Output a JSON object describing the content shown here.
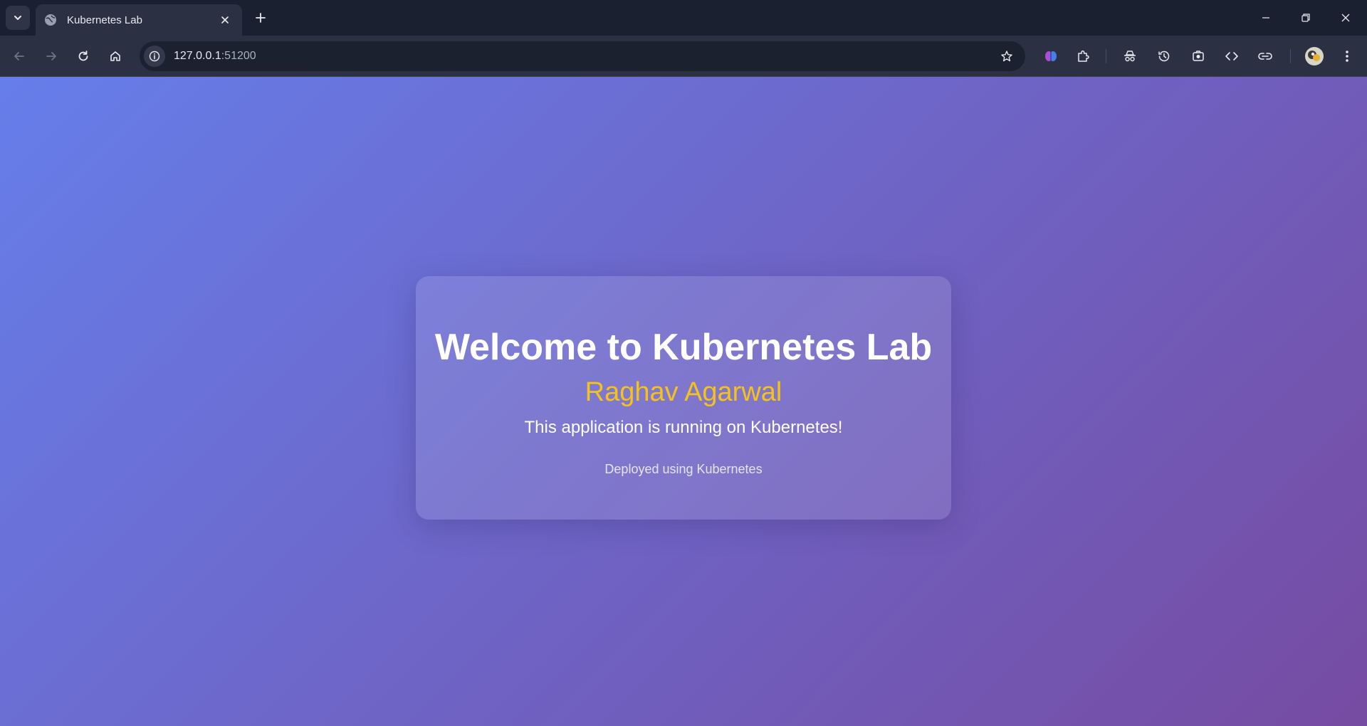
{
  "browser": {
    "tab_title": "Kubernetes Lab",
    "url_host": "127.0.0.1",
    "url_port": ":51200"
  },
  "page": {
    "heading": "Welcome to Kubernetes Lab",
    "name": "Raghav Agarwal",
    "description": "This application is running on Kubernetes!",
    "footer": "Deployed using Kubernetes"
  },
  "colors": {
    "gradient_start": "#667eea",
    "gradient_end": "#764ba2",
    "name_accent": "#f4c21c"
  },
  "icons": {
    "tab_search": "chevron-down-icon",
    "favicon": "globe-icon",
    "tab_close": "close-icon",
    "new_tab": "plus-icon",
    "back": "arrow-left-icon",
    "forward": "arrow-right-icon",
    "reload": "reload-icon",
    "home": "home-icon",
    "site_info": "info-icon",
    "bookmark": "star-icon",
    "extensions": [
      "brain-extension-icon",
      "puzzle-icon",
      "incognito-icon",
      "history-icon",
      "camera-capture-icon",
      "code-icon",
      "link-icon"
    ],
    "menu": "kebab-menu-icon"
  }
}
